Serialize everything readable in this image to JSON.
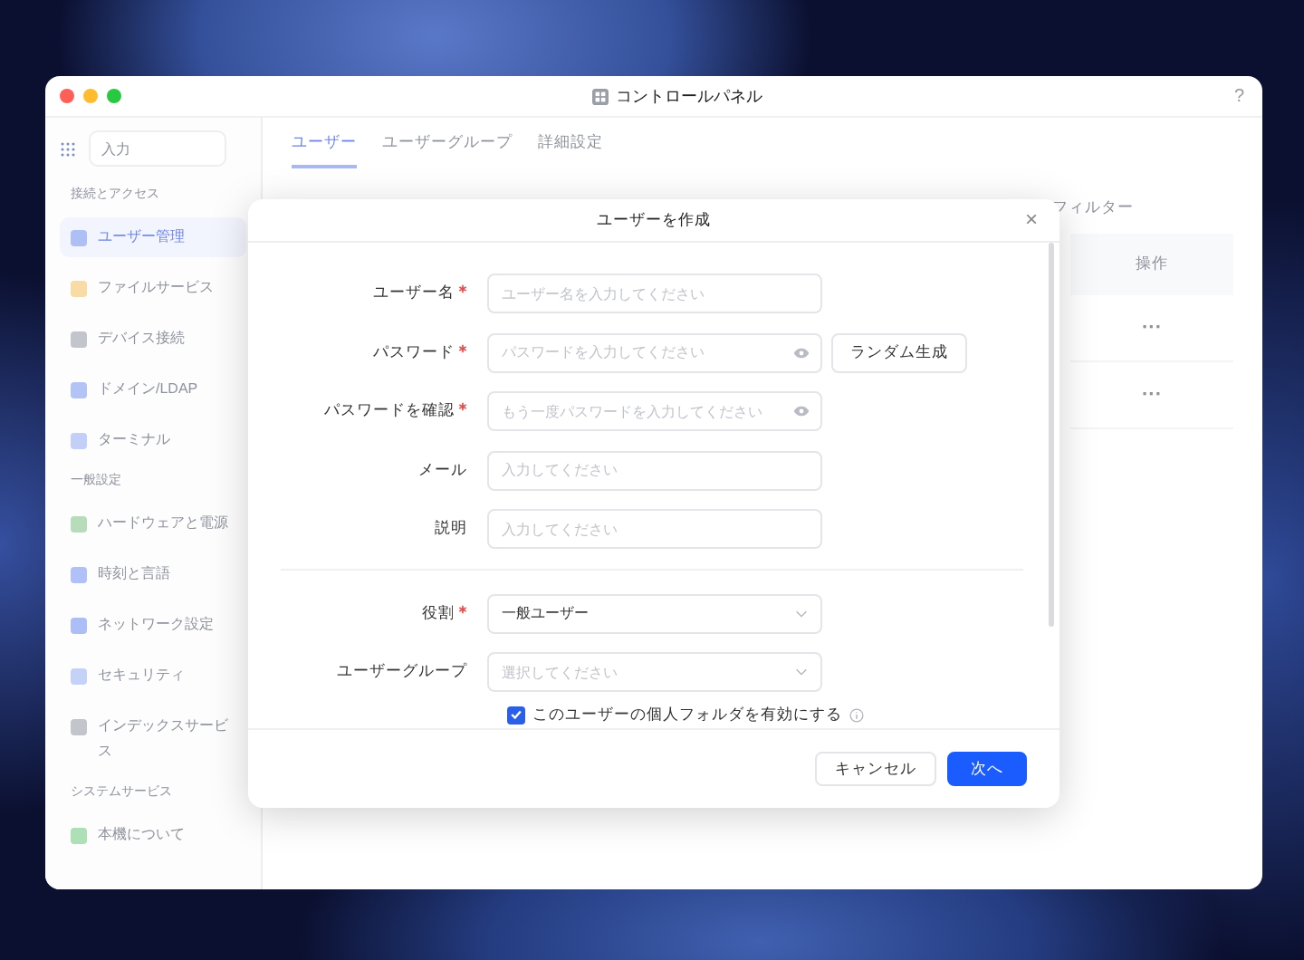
{
  "window": {
    "title": "コントロールパネル",
    "help": "?"
  },
  "sidebar": {
    "search_placeholder": "入力",
    "sections": [
      {
        "title": "接続とアクセス",
        "items": [
          {
            "label": "ユーザー管理",
            "selected": true,
            "color": "#aebff5"
          },
          {
            "label": "ファイルサービス",
            "selected": false,
            "color": "#f8dba6"
          },
          {
            "label": "デバイス接続",
            "selected": false,
            "color": "#c2c5cb"
          },
          {
            "label": "ドメイン/LDAP",
            "selected": false,
            "color": "#b3c3f6"
          },
          {
            "label": "ターミナル",
            "selected": false,
            "color": "#c3cff8"
          }
        ]
      },
      {
        "title": "一般設定",
        "items": [
          {
            "label": "ハードウェアと電源",
            "selected": false,
            "color": "#b7dcb9"
          },
          {
            "label": "時刻と言語",
            "selected": false,
            "color": "#afc1f6"
          },
          {
            "label": "ネットワーク設定",
            "selected": false,
            "color": "#acbef6"
          },
          {
            "label": "セキュリティ",
            "selected": false,
            "color": "#c5d2f8"
          },
          {
            "label": "インデックスサービス",
            "selected": false,
            "color": "#c2c5cb"
          }
        ]
      },
      {
        "title": "システムサービス",
        "items": [
          {
            "label": "本機について",
            "selected": false,
            "color": "#ade0b4"
          }
        ]
      }
    ]
  },
  "tabs": [
    {
      "label": "ユーザー",
      "selected": true
    },
    {
      "label": "ユーザーグループ",
      "selected": false
    },
    {
      "label": "詳細設定",
      "selected": false
    }
  ],
  "table": {
    "filter_label": "フィルター",
    "columns": [
      "操作"
    ],
    "rows": [
      {
        "action": "···"
      },
      {
        "action": "···"
      }
    ]
  },
  "dialog": {
    "title": "ユーザーを作成",
    "close": "×",
    "groups": [
      [
        {
          "kind": "text",
          "label": "ユーザー名",
          "required": true,
          "placeholder": "ユーザー名を入力してください"
        },
        {
          "kind": "password",
          "label": "パスワード",
          "required": true,
          "placeholder": "パスワードを入力してください",
          "button": "ランダム生成"
        },
        {
          "kind": "password",
          "label": "パスワードを確認",
          "required": true,
          "placeholder": "もう一度パスワードを入力してください"
        },
        {
          "kind": "text",
          "label": "メール",
          "required": false,
          "placeholder": "入力してください"
        },
        {
          "kind": "text",
          "label": "説明",
          "required": false,
          "placeholder": "入力してください"
        }
      ],
      [
        {
          "kind": "select",
          "label": "役割",
          "required": true,
          "value": "一般ユーザー"
        },
        {
          "kind": "select",
          "label": "ユーザーグループ",
          "required": false,
          "placeholder": "選択してください"
        }
      ]
    ],
    "checkbox": {
      "label": "このユーザーの個人フォルダを有効にする",
      "checked": true
    },
    "buttons": [
      {
        "label": "キャンセル",
        "kind": "secondary"
      },
      {
        "label": "次へ",
        "kind": "primary"
      }
    ]
  }
}
